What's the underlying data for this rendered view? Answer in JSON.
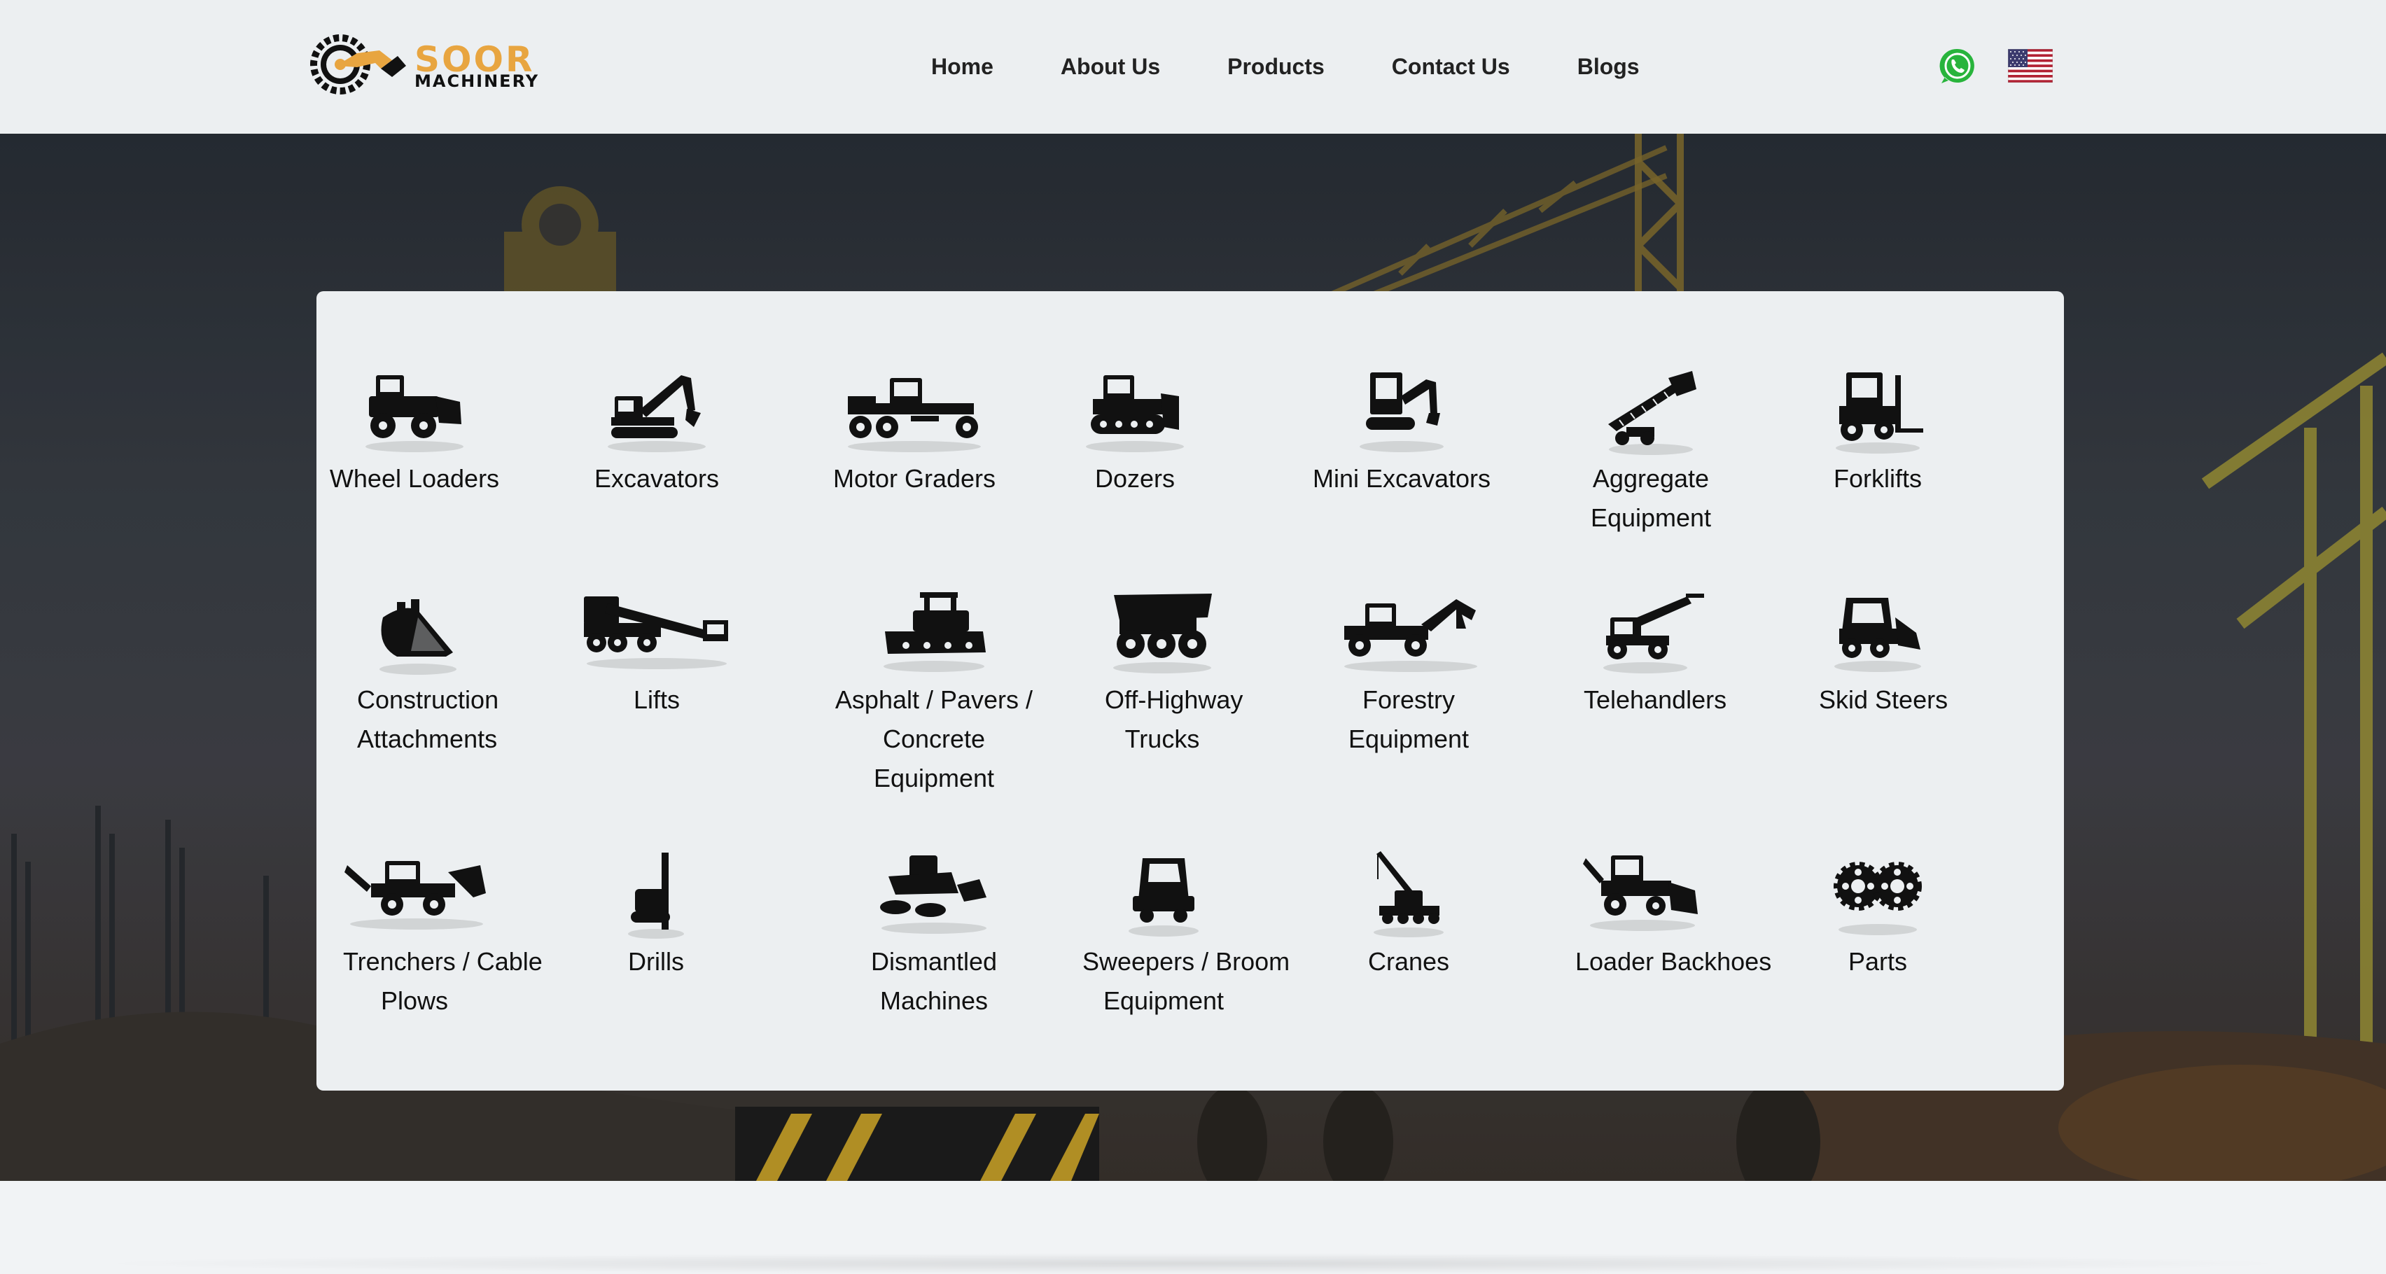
{
  "brand": {
    "name_1": "SOOR",
    "name_2": "MACHINERY",
    "accent": "#e8a540"
  },
  "nav": [
    {
      "label": "Home"
    },
    {
      "label": "About Us"
    },
    {
      "label": "Products"
    },
    {
      "label": "Contact Us"
    },
    {
      "label": "Blogs"
    }
  ],
  "header_icons": {
    "chat": "whatsapp-icon",
    "language": "us-flag-icon"
  },
  "categories": [
    {
      "label": "Wheel Loaders",
      "icon": "wheel-loader-icon"
    },
    {
      "label": "Excavators",
      "icon": "excavator-icon"
    },
    {
      "label": "Motor Graders",
      "icon": "motor-grader-icon"
    },
    {
      "label": "Dozers",
      "icon": "dozer-icon"
    },
    {
      "label": "Mini Excavators",
      "icon": "mini-excavator-icon"
    },
    {
      "label_lines": [
        "Aggregate",
        "Equipment"
      ],
      "icon": "aggregate-equipment-icon"
    },
    {
      "label": "Forklifts",
      "icon": "forklift-icon"
    },
    {
      "label_lines": [
        "Construction",
        "Attachments"
      ],
      "icon": "bucket-attachment-icon"
    },
    {
      "label": "Lifts",
      "icon": "boom-lift-icon"
    },
    {
      "label_lines": [
        "Asphalt / Pavers /",
        "Concrete",
        "Equipment"
      ],
      "icon": "paver-icon"
    },
    {
      "label_lines": [
        "Off-Highway",
        "Trucks"
      ],
      "icon": "dump-truck-icon"
    },
    {
      "label_lines": [
        "Forestry",
        "Equipment"
      ],
      "icon": "forestry-machine-icon"
    },
    {
      "label": "Telehandlers",
      "icon": "telehandler-icon"
    },
    {
      "label": "Skid Steers",
      "icon": "skid-steer-icon"
    },
    {
      "label_lines": [
        "Trenchers / Cable",
        "Plows"
      ],
      "icon": "trencher-icon"
    },
    {
      "label": "Drills",
      "icon": "drill-rig-icon"
    },
    {
      "label_lines": [
        "Dismantled",
        "Machines"
      ],
      "icon": "dismantled-machine-icon"
    },
    {
      "label_lines": [
        "Sweepers / Broom",
        "Equipment"
      ],
      "icon": "sweeper-icon"
    },
    {
      "label": "Cranes",
      "icon": "crane-icon"
    },
    {
      "label": "Loader Backhoes",
      "icon": "loader-backhoe-icon"
    },
    {
      "label": "Parts",
      "icon": "gears-icon"
    }
  ]
}
